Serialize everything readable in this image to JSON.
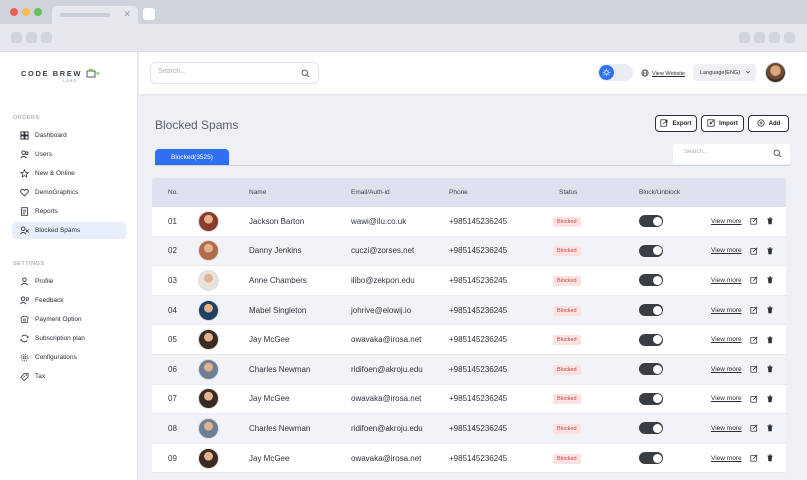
{
  "app": {
    "logo": "CODE BREW",
    "logo_sub": "LABS"
  },
  "sidebar": {
    "section_orders": "ORDERS",
    "orders": [
      {
        "label": "Dashboard",
        "icon": "grid-icon"
      },
      {
        "label": "Users",
        "icon": "users-icon"
      },
      {
        "label": "New & Online",
        "icon": "star-icon"
      },
      {
        "label": "DemoGraphics",
        "icon": "heart-icon"
      },
      {
        "label": "Reports",
        "icon": "report-icon"
      },
      {
        "label": "Blocked Spams",
        "icon": "block-users-icon",
        "active": true
      }
    ],
    "section_settings": "SETTINGS",
    "settings": [
      {
        "label": "Profile",
        "icon": "person-icon"
      },
      {
        "label": "Feedback",
        "icon": "feedback-icon"
      },
      {
        "label": "Payment Option",
        "icon": "payment-icon"
      },
      {
        "label": "Subscription plan",
        "icon": "subscription-icon"
      },
      {
        "label": "Configurations",
        "icon": "config-icon"
      },
      {
        "label": "Tax",
        "icon": "tax-icon"
      }
    ]
  },
  "header": {
    "search_placeholder": "Search...",
    "view_website": "View Website",
    "language": "Language(ENG)"
  },
  "page": {
    "title": "Blocked Spams",
    "export_label": "Export",
    "import_label": "Import",
    "add_label": "Add",
    "tab_label": "Blocked(3525)",
    "table_search_placeholder": "Search..."
  },
  "table": {
    "headers": {
      "no": "No.",
      "name": "Name",
      "email": "Email/Auth-id",
      "phone": "Phone",
      "status": "Status",
      "block": "Block/Unblock"
    },
    "view_more": "View more",
    "rows": [
      {
        "no": "01",
        "name": "Jackson Barton",
        "email": "wawi@ilu.co.uk",
        "phone": "+985145236245",
        "status": "Blocked",
        "avatar": "#8a3b2c"
      },
      {
        "no": "02",
        "name": "Danny Jenkins",
        "email": "cuczi@zorses.net",
        "phone": "+985145236245",
        "status": "Blocked",
        "avatar": "#b06a4c"
      },
      {
        "no": "03",
        "name": "Anne Chambers",
        "email": "ilibo@zekpon.edu",
        "phone": "+985145236245",
        "status": "Blocked",
        "avatar": "#e7e2de"
      },
      {
        "no": "04",
        "name": "Mabel Singleton",
        "email": "johrive@elowij.io",
        "phone": "+985145236245",
        "status": "Blocked",
        "avatar": "#1f3f63"
      },
      {
        "no": "05",
        "name": "Jay McGee",
        "email": "owavaka@irosa.net",
        "phone": "+985145236245",
        "status": "Blocked",
        "avatar": "#3a2c22"
      },
      {
        "no": "06",
        "name": "Charles Newman",
        "email": "ridifoen@akroju.edu",
        "phone": "+985145236245",
        "status": "Blocked",
        "avatar": "#6f7f96"
      },
      {
        "no": "07",
        "name": "Jay McGee",
        "email": "owavaka@irosa.net",
        "phone": "+985145236245",
        "status": "Blocked",
        "avatar": "#3a2c22"
      },
      {
        "no": "08",
        "name": "Charles Newman",
        "email": "ridifoen@akroju.edu",
        "phone": "+985145236245",
        "status": "Blocked",
        "avatar": "#6f7f96"
      },
      {
        "no": "09",
        "name": "Jay McGee",
        "email": "owavaka@irosa.net",
        "phone": "+985145236245",
        "status": "Blocked",
        "avatar": "#3a2c22"
      }
    ]
  },
  "colors": {
    "accent": "#2f6ff2",
    "status_bg": "#fde1e1",
    "status_text": "#c24848"
  }
}
